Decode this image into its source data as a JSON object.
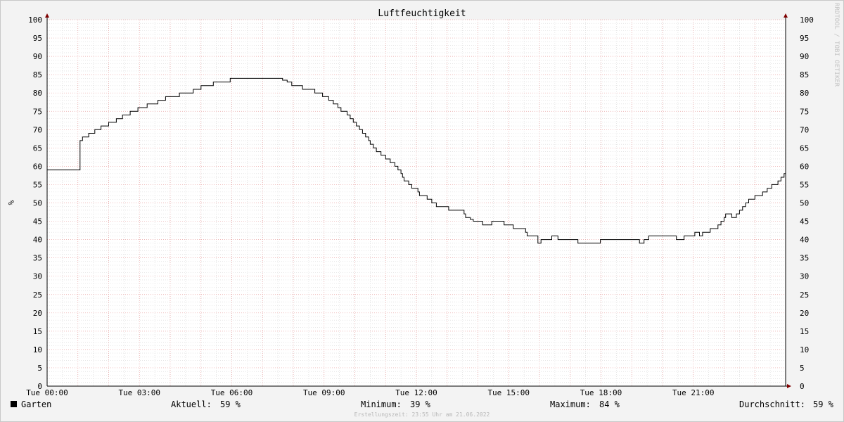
{
  "chart_data": {
    "type": "line",
    "title": "Luftfeuchtigkeit",
    "ylabel": "%",
    "ylim": [
      0,
      100
    ],
    "yticks": [
      0,
      5,
      10,
      15,
      20,
      25,
      30,
      35,
      40,
      45,
      50,
      55,
      60,
      65,
      70,
      75,
      80,
      85,
      90,
      95,
      100
    ],
    "xlim": [
      0,
      24
    ],
    "xtick_hours": [
      0,
      3,
      6,
      9,
      12,
      15,
      18,
      21
    ],
    "xtick_labels": [
      "Tue 00:00",
      "Tue 03:00",
      "Tue 06:00",
      "Tue 09:00",
      "Tue 12:00",
      "Tue 15:00",
      "Tue 18:00",
      "Tue 21:00"
    ],
    "grid": true,
    "legend_position": "bottom-left",
    "series": [
      {
        "name": "Garten",
        "color": "#000000",
        "points": [
          [
            0.0,
            59
          ],
          [
            1.07,
            59
          ],
          [
            1.07,
            67
          ],
          [
            1.15,
            68
          ],
          [
            1.35,
            69
          ],
          [
            1.55,
            70
          ],
          [
            1.75,
            71
          ],
          [
            2.0,
            72
          ],
          [
            2.25,
            73
          ],
          [
            2.45,
            74
          ],
          [
            2.7,
            75
          ],
          [
            2.95,
            76
          ],
          [
            3.25,
            77
          ],
          [
            3.6,
            78
          ],
          [
            3.85,
            79
          ],
          [
            4.3,
            80
          ],
          [
            4.75,
            81
          ],
          [
            5.0,
            82
          ],
          [
            5.4,
            83
          ],
          [
            5.95,
            84
          ],
          [
            7.6,
            84
          ],
          [
            7.65,
            83.5
          ],
          [
            7.8,
            83
          ],
          [
            7.95,
            82
          ],
          [
            8.3,
            81
          ],
          [
            8.7,
            80
          ],
          [
            8.95,
            79
          ],
          [
            9.15,
            78
          ],
          [
            9.3,
            77
          ],
          [
            9.45,
            76
          ],
          [
            9.55,
            75
          ],
          [
            9.75,
            74
          ],
          [
            9.85,
            73
          ],
          [
            9.95,
            72
          ],
          [
            10.05,
            71
          ],
          [
            10.15,
            70
          ],
          [
            10.25,
            69
          ],
          [
            10.35,
            68
          ],
          [
            10.45,
            67
          ],
          [
            10.5,
            66
          ],
          [
            10.6,
            65
          ],
          [
            10.7,
            64
          ],
          [
            10.85,
            63
          ],
          [
            11.0,
            62
          ],
          [
            11.15,
            61
          ],
          [
            11.3,
            60
          ],
          [
            11.4,
            59
          ],
          [
            11.5,
            58
          ],
          [
            11.55,
            57
          ],
          [
            11.6,
            56
          ],
          [
            11.75,
            55
          ],
          [
            11.85,
            54
          ],
          [
            12.05,
            53
          ],
          [
            12.1,
            52
          ],
          [
            12.35,
            51
          ],
          [
            12.5,
            50
          ],
          [
            12.65,
            49
          ],
          [
            13.05,
            48
          ],
          [
            13.55,
            47
          ],
          [
            13.6,
            46
          ],
          [
            13.75,
            45.5
          ],
          [
            13.85,
            45
          ],
          [
            14.15,
            44
          ],
          [
            14.45,
            45
          ],
          [
            14.85,
            44
          ],
          [
            15.15,
            43
          ],
          [
            15.55,
            42
          ],
          [
            15.6,
            41
          ],
          [
            15.9,
            41
          ],
          [
            15.95,
            39
          ],
          [
            16.05,
            40
          ],
          [
            16.3,
            40
          ],
          [
            16.4,
            41
          ],
          [
            16.55,
            41
          ],
          [
            16.6,
            40
          ],
          [
            17.2,
            40
          ],
          [
            17.25,
            39
          ],
          [
            17.95,
            39
          ],
          [
            17.98,
            40
          ],
          [
            19.2,
            40
          ],
          [
            19.25,
            39
          ],
          [
            19.35,
            39
          ],
          [
            19.4,
            40
          ],
          [
            19.55,
            41
          ],
          [
            20.4,
            41
          ],
          [
            20.45,
            40
          ],
          [
            20.65,
            40
          ],
          [
            20.7,
            41
          ],
          [
            21.0,
            41
          ],
          [
            21.05,
            42
          ],
          [
            21.15,
            42
          ],
          [
            21.2,
            41
          ],
          [
            21.3,
            42
          ],
          [
            21.55,
            43
          ],
          [
            21.8,
            44
          ],
          [
            21.9,
            45
          ],
          [
            22.0,
            46
          ],
          [
            22.05,
            47
          ],
          [
            22.2,
            47
          ],
          [
            22.25,
            46
          ],
          [
            22.4,
            47
          ],
          [
            22.5,
            48
          ],
          [
            22.6,
            49
          ],
          [
            22.7,
            50
          ],
          [
            22.8,
            51
          ],
          [
            23.0,
            52
          ],
          [
            23.25,
            53
          ],
          [
            23.4,
            54
          ],
          [
            23.55,
            55
          ],
          [
            23.75,
            56
          ],
          [
            23.85,
            57
          ],
          [
            23.95,
            58
          ],
          [
            24.1,
            59
          ],
          [
            24.2,
            59
          ]
        ]
      }
    ]
  },
  "legend": {
    "swatch_color": "#000000",
    "label": "Garten"
  },
  "stats": {
    "current_label": "Aktuell:",
    "current_value": "59 %",
    "min_label": "Minimum:",
    "min_value": "39 %",
    "max_label": "Maximum:",
    "max_value": "84 %",
    "avg_label": "Durchschnitt:",
    "avg_value": "59 %"
  },
  "footer_text": "Erstellungszeit: 23:55 Uhr am 21.06.2022",
  "watermark": "RRDTOOL / TOBI OETIKER",
  "colors": {
    "background": "#f3f3f3",
    "canvas": "#ffffff",
    "major_grid": "#e8a0a0",
    "minor_grid": "#d6d6d6",
    "axis": "#800000",
    "line": "#000000"
  }
}
